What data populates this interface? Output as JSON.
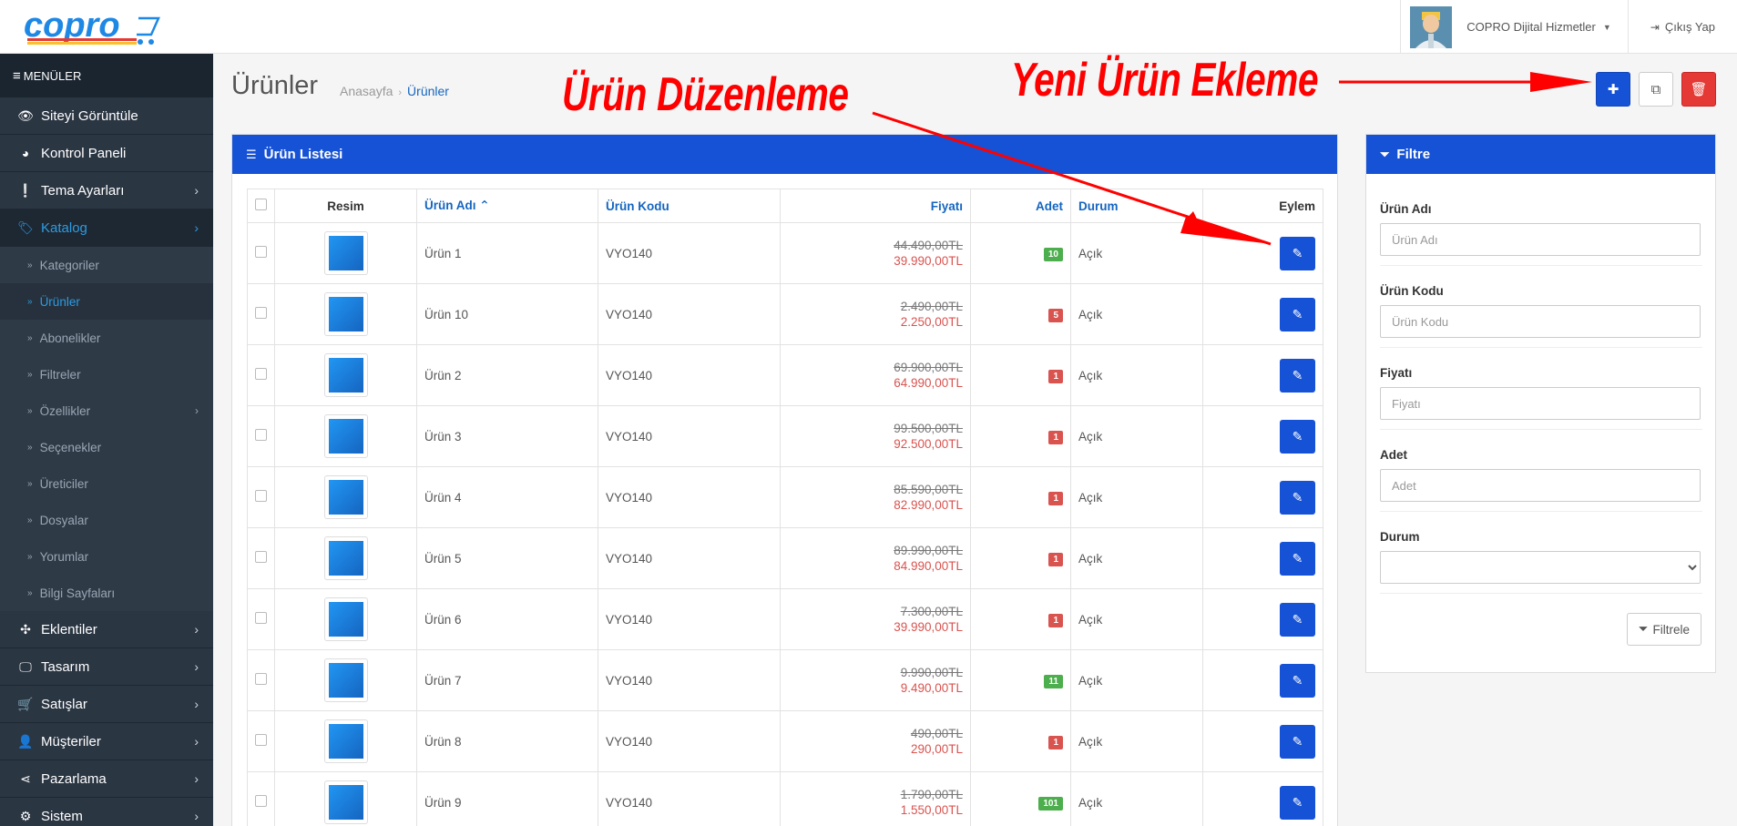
{
  "header": {
    "logo_text": "copro",
    "user_name": "COPRO Dijital Hizmetler",
    "logout_label": "Çıkış Yap"
  },
  "sidebar": {
    "menu_title": "MENÜLER",
    "items": [
      {
        "label": "Siteyi Görüntüle",
        "icon": "eye-icon",
        "chevron": false
      },
      {
        "label": "Kontrol Paneli",
        "icon": "dashboard-icon",
        "chevron": false
      },
      {
        "label": "Tema Ayarları",
        "icon": "exclamation-icon",
        "chevron": true
      },
      {
        "label": "Katalog",
        "icon": "tags-icon",
        "chevron": true,
        "active": true
      }
    ],
    "sub_items": [
      {
        "label": "Kategoriler"
      },
      {
        "label": "Ürünler",
        "active": true
      },
      {
        "label": "Abonelikler"
      },
      {
        "label": "Filtreler"
      },
      {
        "label": "Özellikler",
        "chevron": true
      },
      {
        "label": "Seçenekler"
      },
      {
        "label": "Üreticiler"
      },
      {
        "label": "Dosyalar"
      },
      {
        "label": "Yorumlar"
      },
      {
        "label": "Bilgi Sayfaları"
      }
    ],
    "bottom_items": [
      {
        "label": "Eklentiler",
        "icon": "puzzle-icon"
      },
      {
        "label": "Tasarım",
        "icon": "monitor-icon"
      },
      {
        "label": "Satışlar",
        "icon": "cart-icon"
      },
      {
        "label": "Müşteriler",
        "icon": "user-icon"
      },
      {
        "label": "Pazarlama",
        "icon": "share-icon"
      },
      {
        "label": "Sistem",
        "icon": "gear-icon"
      }
    ]
  },
  "page": {
    "title": "Ürünler",
    "breadcrumb_home": "Anasayfa",
    "breadcrumb_current": "Ürünler"
  },
  "list": {
    "title": "Ürün Listesi",
    "columns": {
      "image": "Resim",
      "name": "Ürün Adı",
      "code": "Ürün Kodu",
      "price": "Fiyatı",
      "quantity": "Adet",
      "status": "Durum",
      "action": "Eylem"
    },
    "rows": [
      {
        "name": "Ürün 1",
        "code": "VYO140",
        "old_price": "44.490,00TL",
        "price": "39.990,00TL",
        "qty": "10",
        "qty_color": "green",
        "status": "Açık"
      },
      {
        "name": "Ürün 10",
        "code": "VYO140",
        "old_price": "2.490,00TL",
        "price": "2.250,00TL",
        "qty": "5",
        "qty_color": "red",
        "status": "Açık"
      },
      {
        "name": "Ürün 2",
        "code": "VYO140",
        "old_price": "69.900,00TL",
        "price": "64.990,00TL",
        "qty": "1",
        "qty_color": "red",
        "status": "Açık"
      },
      {
        "name": "Ürün 3",
        "code": "VYO140",
        "old_price": "99.500,00TL",
        "price": "92.500,00TL",
        "qty": "1",
        "qty_color": "red",
        "status": "Açık"
      },
      {
        "name": "Ürün 4",
        "code": "VYO140",
        "old_price": "85.590,00TL",
        "price": "82.990,00TL",
        "qty": "1",
        "qty_color": "red",
        "status": "Açık"
      },
      {
        "name": "Ürün 5",
        "code": "VYO140",
        "old_price": "89.990,00TL",
        "price": "84.990,00TL",
        "qty": "1",
        "qty_color": "red",
        "status": "Açık"
      },
      {
        "name": "Ürün 6",
        "code": "VYO140",
        "old_price": "7.300,00TL",
        "price": "39.990,00TL",
        "qty": "1",
        "qty_color": "red",
        "status": "Açık"
      },
      {
        "name": "Ürün 7",
        "code": "VYO140",
        "old_price": "9.990,00TL",
        "price": "9.490,00TL",
        "qty": "11",
        "qty_color": "green",
        "status": "Açık"
      },
      {
        "name": "Ürün 8",
        "code": "VYO140",
        "old_price": "490,00TL",
        "price": "290,00TL",
        "qty": "1",
        "qty_color": "red",
        "status": "Açık"
      },
      {
        "name": "Ürün 9",
        "code": "VYO140",
        "old_price": "1.790,00TL",
        "price": "1.550,00TL",
        "qty": "101",
        "qty_color": "green",
        "status": "Açık"
      }
    ]
  },
  "filter": {
    "title": "Filtre",
    "name_label": "Ürün Adı",
    "name_placeholder": "Ürün Adı",
    "code_label": "Ürün Kodu",
    "code_placeholder": "Ürün Kodu",
    "price_label": "Fiyatı",
    "price_placeholder": "Fiyatı",
    "qty_label": "Adet",
    "qty_placeholder": "Adet",
    "status_label": "Durum",
    "status_value": "",
    "button_label": "Filtrele"
  },
  "annotations": {
    "edit_note": "Ürün Düzenleme",
    "add_note": "Yeni Ürün Ekleme",
    "color": "#ff0000"
  },
  "colors": {
    "primary": "#1652d6",
    "sidebar": "#2b3643",
    "active_link": "#2e9be0",
    "danger": "#e53935"
  }
}
